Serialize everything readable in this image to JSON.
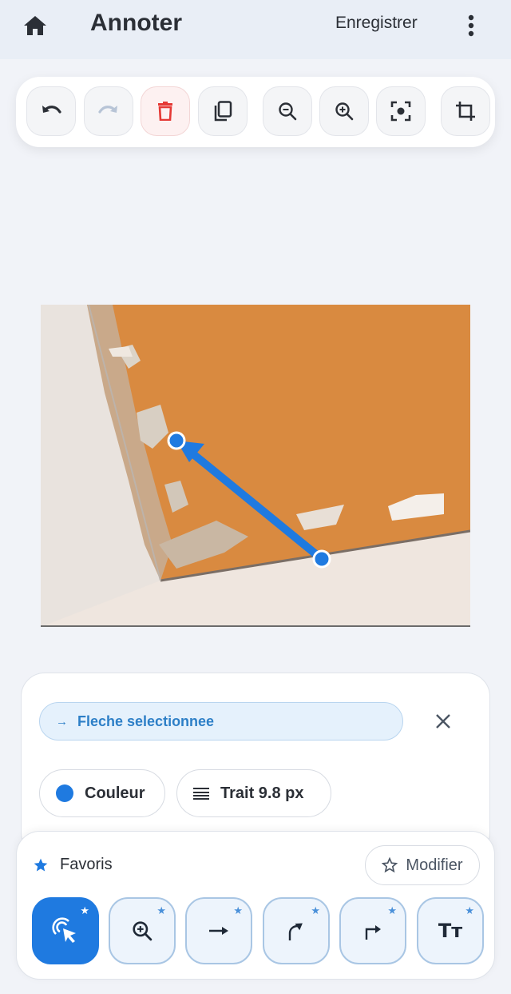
{
  "header": {
    "title": "Annoter",
    "save_label": "Enregistrer"
  },
  "toolbar": {
    "tools": [
      "undo-icon",
      "redo-icon",
      "trash-icon",
      "duplicate-icon",
      "zoom-out-icon",
      "zoom-in-icon",
      "focus-icon",
      "crop-icon"
    ]
  },
  "annotation": {
    "type": "arrow",
    "color": "#1f7ae0"
  },
  "selection": {
    "chip_label": "Fleche selectionnee",
    "color_label": "Couleur",
    "stroke_label": "Trait 9.8 px"
  },
  "favorites": {
    "title": "Favoris",
    "modify_label": "Modifier",
    "tools": [
      "select-tool-icon",
      "zoom-tool-icon",
      "arrow-tool-icon",
      "curved-arrow-tool-icon",
      "elbow-arrow-tool-icon"
    ],
    "text_tool_label": "Tт"
  },
  "colors": {
    "accent": "#1f7ae0",
    "danger": "#e53935",
    "wall": "#d98a40"
  }
}
